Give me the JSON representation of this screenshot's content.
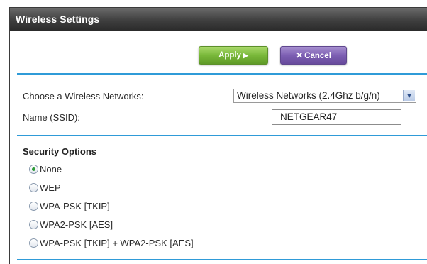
{
  "panel": {
    "title": "Wireless Settings"
  },
  "actions": {
    "apply_label": "Apply",
    "cancel_label": "Cancel"
  },
  "form": {
    "network_label": "Choose a Wireless Networks:",
    "network_value": "Wireless Networks (2.4Ghz b/g/n)",
    "ssid_label": "Name (SSID):",
    "ssid_value": "NETGEAR47"
  },
  "security": {
    "title": "Security Options",
    "selected": "None",
    "options": [
      {
        "label": "None"
      },
      {
        "label": "WEP"
      },
      {
        "label": "WPA-PSK [TKIP]"
      },
      {
        "label": "WPA2-PSK [AES]"
      },
      {
        "label": "WPA-PSK [TKIP] + WPA2-PSK [AES]"
      }
    ]
  },
  "colors": {
    "accent_divider": "#2f9bd8",
    "apply_green": "#79b83a",
    "cancel_purple": "#7d5fb3",
    "titlebar": "#3e3e3e",
    "radio_selected": "#2e9b3a"
  }
}
